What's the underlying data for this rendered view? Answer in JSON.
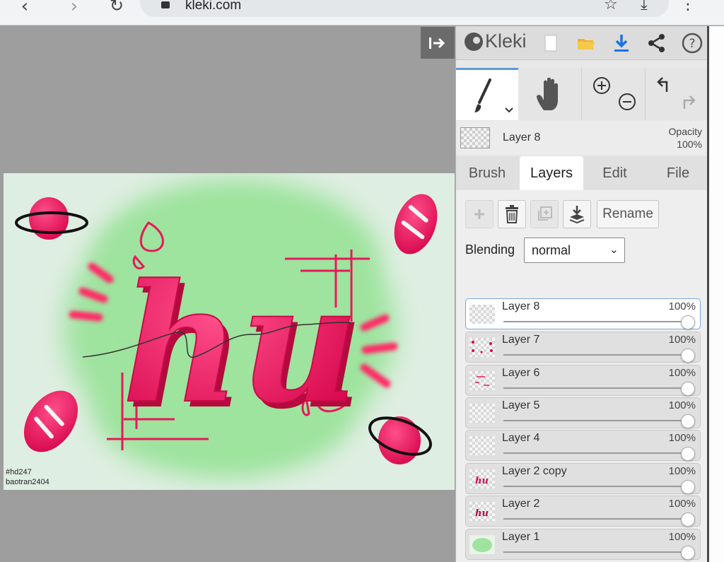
{
  "browser": {
    "url": "kleki.com",
    "back_icon": "back-arrow-icon",
    "forward_icon": "forward-arrow-icon",
    "reload_icon": "reload-icon"
  },
  "canvas": {
    "collapse_icon": "collapse-panel-icon",
    "watermark_line1": "#hd247",
    "watermark_line2": "baotran2404",
    "art_text": "hu"
  },
  "app": {
    "name": "Kleki",
    "accent_color": "#5b9bd5"
  },
  "toolbar": {
    "icons": [
      "new-file-icon",
      "open-folder-icon",
      "download-icon",
      "share-icon",
      "help-icon"
    ]
  },
  "tools": {
    "brush": "brush-icon",
    "hand": "hand-icon",
    "zoom_in": "zoom-in-icon",
    "zoom_out": "zoom-out-icon",
    "undo": "undo-icon",
    "redo": "redo-icon"
  },
  "current_layer": {
    "name": "Layer 8",
    "opacity_label": "Opacity",
    "opacity_value": "100%"
  },
  "tabs": [
    {
      "label": "Brush",
      "active": false
    },
    {
      "label": "Layers",
      "active": true
    },
    {
      "label": "Edit",
      "active": false
    },
    {
      "label": "File",
      "active": false
    }
  ],
  "layer_actions": {
    "rename_label": "Rename"
  },
  "blending": {
    "label": "Blending",
    "value": "normal"
  },
  "layers": [
    {
      "name": "Layer 8",
      "opacity": "100%",
      "selected": true,
      "opacity_fraction": 1.0
    },
    {
      "name": "Layer 7",
      "opacity": "100%",
      "selected": false,
      "opacity_fraction": 1.0
    },
    {
      "name": "Layer 6",
      "opacity": "100%",
      "selected": false,
      "opacity_fraction": 1.0
    },
    {
      "name": "Layer 5",
      "opacity": "100%",
      "selected": false,
      "opacity_fraction": 1.0
    },
    {
      "name": "Layer 4",
      "opacity": "100%",
      "selected": false,
      "opacity_fraction": 1.0
    },
    {
      "name": "Layer 2 copy",
      "opacity": "100%",
      "selected": false,
      "opacity_fraction": 1.0
    },
    {
      "name": "Layer 2",
      "opacity": "100%",
      "selected": false,
      "opacity_fraction": 1.0
    },
    {
      "name": "Layer 1",
      "opacity": "100%",
      "selected": false,
      "opacity_fraction": 1.0
    }
  ]
}
